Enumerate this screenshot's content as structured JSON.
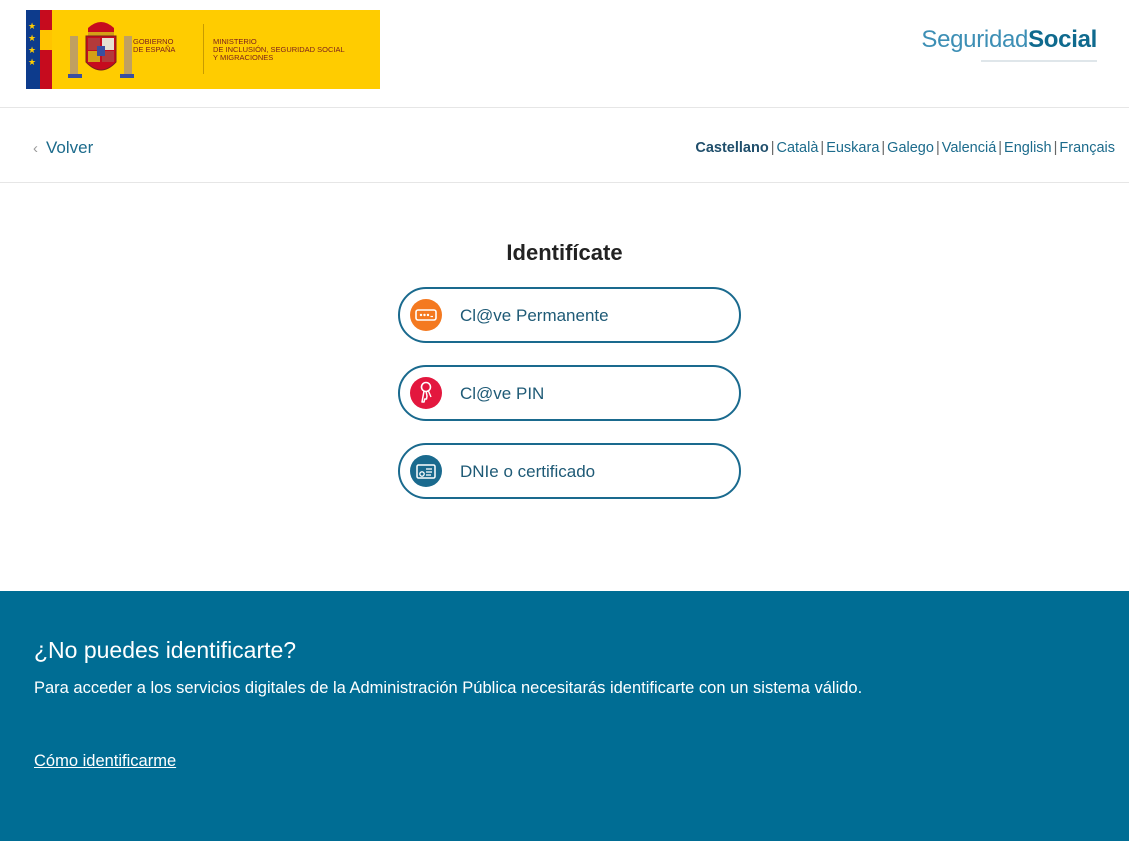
{
  "header": {
    "gov_line1": "GOBIERNO",
    "gov_line2": "DE ESPAÑA",
    "min_line1": "MINISTERIO",
    "min_line2": "DE INCLUSIÓN, SEGURIDAD SOCIAL",
    "min_line3": "Y MIGRACIONES",
    "brand_light": "Seguridad",
    "brand_bold": "Social"
  },
  "nav": {
    "back_label": "Volver",
    "languages": [
      "Castellano",
      "Català",
      "Euskara",
      "Galego",
      "Valenciá",
      "English",
      "Français"
    ],
    "active_language": "Castellano"
  },
  "main": {
    "title": "Identifícate",
    "options": [
      {
        "label": "Cl@ve Permanente",
        "icon": "password-icon",
        "color": "#f47920"
      },
      {
        "label": "Cl@ve PIN",
        "icon": "key-icon",
        "color": "#e3173e"
      },
      {
        "label": "DNIe o certificado",
        "icon": "certificate-icon",
        "color": "#1a6a8e"
      }
    ]
  },
  "footer": {
    "title": "¿No puedes identificarte?",
    "description": "Para acceder a los servicios digitales de la Administración Pública necesitarás identificarte con un sistema válido.",
    "link": "Cómo identificarme",
    "background": "#006d94"
  }
}
